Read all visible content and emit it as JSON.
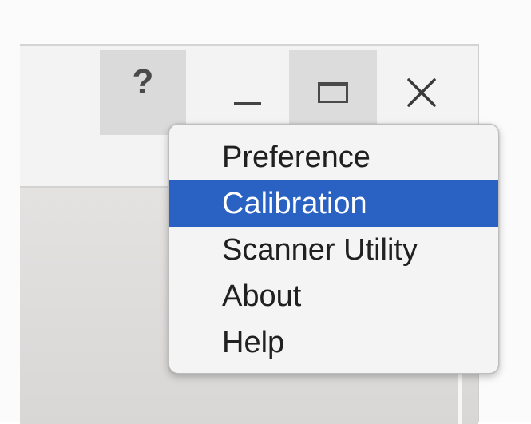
{
  "titlebar": {
    "help_label": "?",
    "minimize_icon": "minimize-icon",
    "maximize_icon": "maximize-icon",
    "close_icon": "close-icon"
  },
  "menu": {
    "selected_index": 1,
    "items": [
      {
        "label": "Preference"
      },
      {
        "label": "Calibration"
      },
      {
        "label": "Scanner Utility"
      },
      {
        "label": "About"
      },
      {
        "label": "Help"
      }
    ],
    "highlight_color": "#2a62c4"
  }
}
